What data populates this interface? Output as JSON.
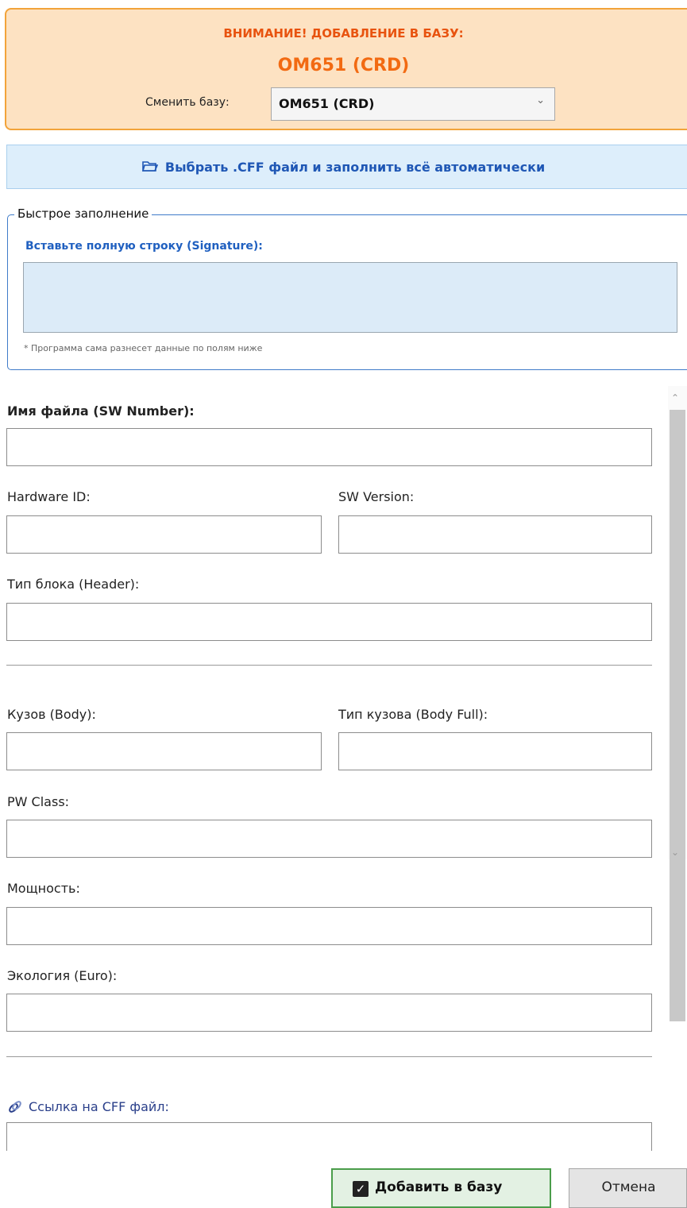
{
  "warning": {
    "title": "ВНИМАНИЕ! ДОБАВЛЕНИЕ В БАЗУ:",
    "base_name": "OM651 (CRD)",
    "switch_label": "Сменить базу:",
    "selected_base": "OM651 (CRD)"
  },
  "cff_button": {
    "label": "Выбрать .CFF файл и заполнить всё автоматически",
    "icon": "folder-icon"
  },
  "quick_fill": {
    "legend": "Быстрое заполнение",
    "signature_label": "Вставьте полную строку (Signature):",
    "signature_value": "",
    "hint": "* Программа сама разнесет данные по полям ниже"
  },
  "form": {
    "sw_number": {
      "label": "Имя файла (SW Number):",
      "value": ""
    },
    "hardware_id": {
      "label": "Hardware ID:",
      "value": ""
    },
    "sw_version": {
      "label": "SW Version:",
      "value": ""
    },
    "header": {
      "label": "Тип блока (Header):",
      "value": ""
    },
    "body": {
      "label": "Кузов (Body):",
      "value": ""
    },
    "body_full": {
      "label": "Тип кузова (Body Full):",
      "value": ""
    },
    "pw_class": {
      "label": "PW Class:",
      "value": ""
    },
    "power": {
      "label": "Мощность:",
      "value": ""
    },
    "euro": {
      "label": "Экология (Euro):",
      "value": ""
    },
    "cff_link": {
      "label": "Ссылка на CFF файл:",
      "icon": "link-icon",
      "value": ""
    }
  },
  "actions": {
    "add_label": "Добавить в базу",
    "cancel_label": "Отмена"
  },
  "colors": {
    "warning_bg": "#fde2c2",
    "warning_border": "#f2a33a",
    "warning_text": "#e8530f",
    "accent_blue": "#1f57b5",
    "add_border": "#4a9d4a"
  }
}
